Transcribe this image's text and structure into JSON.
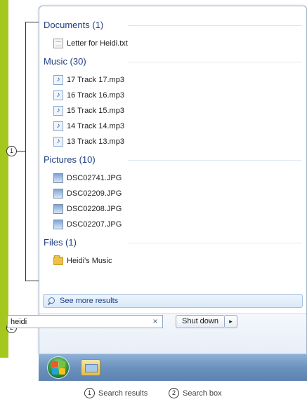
{
  "callouts": {
    "one": "1",
    "two": "2"
  },
  "results": {
    "groups": [
      {
        "title": "Documents (1)",
        "icon": "document-icon",
        "items": [
          "Letter for Heidi.txt"
        ]
      },
      {
        "title": "Music (30)",
        "icon": "audio-file-icon",
        "items": [
          "17 Track 17.mp3",
          "16 Track 16.mp3",
          "15 Track 15.mp3",
          "14 Track 14.mp3",
          "13 Track 13.mp3"
        ]
      },
      {
        "title": "Pictures (10)",
        "icon": "image-file-icon",
        "items": [
          "DSC02741.JPG",
          "DSC02209.JPG",
          "DSC02208.JPG",
          "DSC02207.JPG"
        ]
      },
      {
        "title": "Files (1)",
        "icon": "folder-icon",
        "items": [
          "Heidi's Music"
        ]
      }
    ]
  },
  "see_more": {
    "label": "See more results"
  },
  "search": {
    "value": "heidi",
    "clear_glyph": "×"
  },
  "shutdown": {
    "label": "Shut down",
    "arrow_glyph": "▸"
  },
  "legend": [
    {
      "number": "1",
      "label": "Search results"
    },
    {
      "number": "2",
      "label": "Search box"
    }
  ],
  "colors": {
    "accent_bar": "#a6c81e",
    "group_header": "#1f3f84",
    "taskbar": "#6b91bd"
  }
}
